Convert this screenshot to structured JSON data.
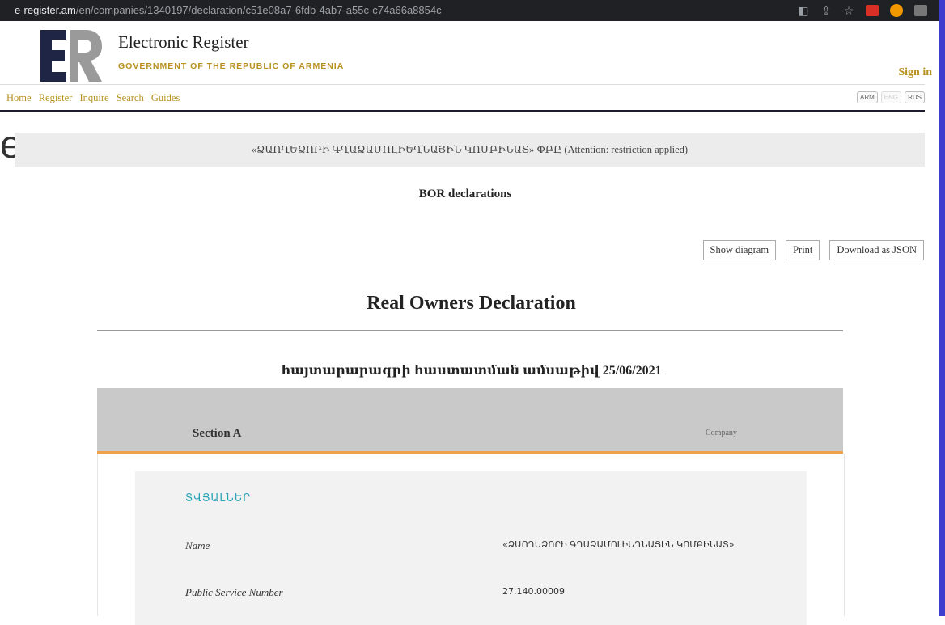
{
  "browser": {
    "domain": "e-register.am",
    "path": "/en/companies/1340197/declaration/c51e08a7-6fdb-4ab7-a55c-c74a66a8854c"
  },
  "header": {
    "title": "Electronic Register",
    "subtitle": "GOVERNMENT OF THE REPUBLIC OF ARMENIA",
    "sign_in": "Sign in"
  },
  "nav": {
    "items": [
      "Home",
      "Register",
      "Inquire",
      "Search",
      "Guides"
    ],
    "languages": [
      "ARM",
      "ENG",
      "RUS"
    ]
  },
  "stray_text": "e",
  "banner": {
    "text": "«ՁԱՈՂԵՁՈՐԻ ԳՂԱՁԱՄՈԼԻԵՂՆԱՅԻՆ ԿՈՄԲԻՆԱՏ» ՓԲԸ (Attention: restriction applied)"
  },
  "page": {
    "bor_title": "BOR declarations",
    "buttons": {
      "show_diagram": "Show diagram",
      "print": "Print",
      "download_json": "Download as JSON"
    },
    "declaration_title": "Real Owners Declaration",
    "declaration_date": "հայտարարագրի հաստատման ամսաթիվ 25/06/2021"
  },
  "section": {
    "label": "Section A",
    "type": "Company",
    "card_heading": "ՏՎՅԱԼՆԵՐ",
    "rows": [
      {
        "label": "Name",
        "value": "«ՁԱՈՂԵՁՈՐԻ ԳՂԱՁԱՄՈԼԻԵՂՆԱՅԻՆ ԿՈՄԲԻՆԱՏ»"
      },
      {
        "label": "Public Service Number",
        "value": "27.140.00009"
      }
    ]
  }
}
